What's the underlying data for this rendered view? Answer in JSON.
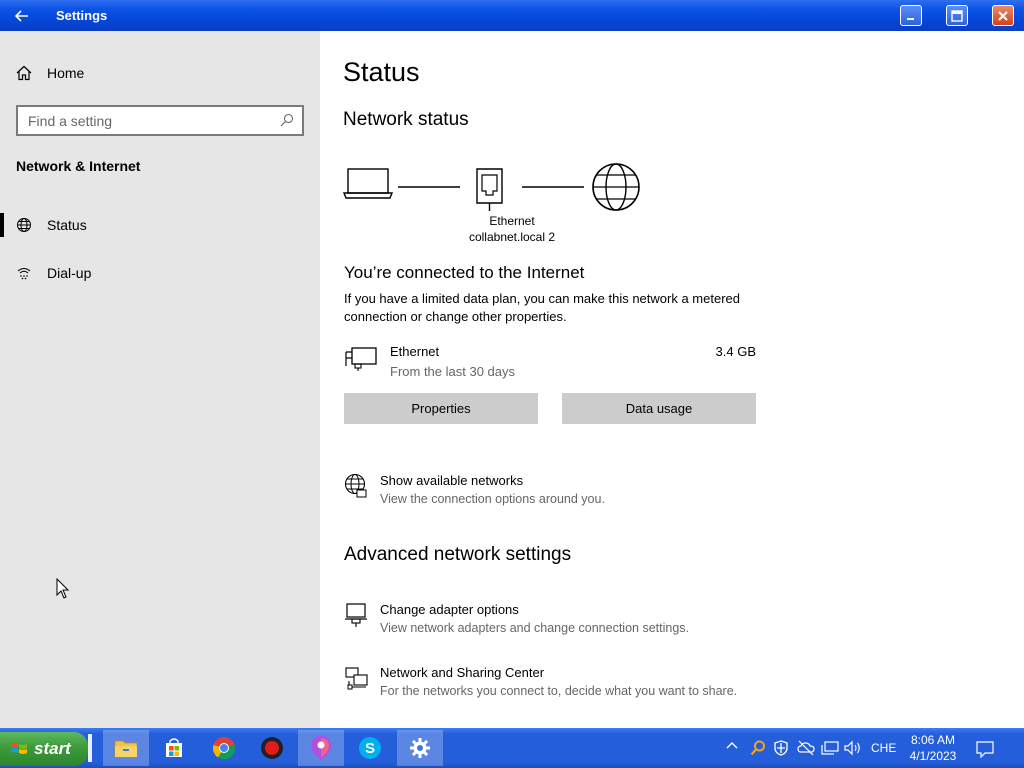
{
  "window": {
    "title": "Settings"
  },
  "sidebar": {
    "home_label": "Home",
    "search_placeholder": "Find a setting",
    "section_title": "Network & Internet",
    "items": [
      {
        "label": "Status",
        "selected": true
      },
      {
        "label": "Dial-up",
        "selected": false
      }
    ]
  },
  "main": {
    "title": "Status",
    "network_status_heading": "Network status",
    "diagram_label_line1": "Ethernet",
    "diagram_label_line2": "collabnet.local 2",
    "connected_heading": "You’re connected to the Internet",
    "connected_text": "If you have a limited data plan, you can make this network a metered connection or change other properties.",
    "adapter": {
      "name": "Ethernet",
      "sub": "From the last 30 days",
      "usage": "3.4 GB"
    },
    "buttons": {
      "properties": "Properties",
      "data_usage": "Data usage"
    },
    "show_networks": {
      "title": "Show available networks",
      "desc": "View the connection options around you."
    },
    "advanced_heading": "Advanced network settings",
    "change_adapter": {
      "title": "Change adapter options",
      "desc": "View network adapters and change connection settings."
    },
    "sharing_center": {
      "title": "Network and Sharing Center",
      "desc": "For the networks you connect to, decide what you want to share."
    }
  },
  "taskbar": {
    "start_label": "start",
    "language": "CHE",
    "time": "8:06 AM",
    "date": "4/1/2023"
  }
}
